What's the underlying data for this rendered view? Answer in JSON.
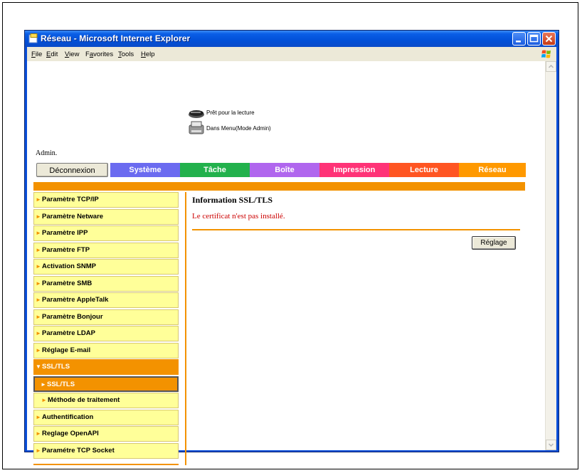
{
  "window": {
    "title": "Réseau - Microsoft Internet Explorer"
  },
  "menu": [
    {
      "u": "F",
      "rest": "ile"
    },
    {
      "u": "E",
      "rest": "dit"
    },
    {
      "u": "V",
      "rest": "iew"
    },
    {
      "u": "",
      "pre": "F",
      "mid": "a",
      "rest": "vorites"
    },
    {
      "u": "T",
      "rest": "ools"
    },
    {
      "u": "H",
      "rest": "elp"
    }
  ],
  "status": {
    "line1": "Prêt pour la lecture",
    "line2": "Dans Menu(Mode Admin)"
  },
  "admin_label": "Admin.",
  "nav": {
    "logout": "Déconnexion",
    "tabs": [
      {
        "label": "Système",
        "color": "#6b6bf0"
      },
      {
        "label": "Tâche",
        "color": "#22b14c"
      },
      {
        "label": "Boîte",
        "color": "#b066ee"
      },
      {
        "label": "Impression",
        "color": "#ff3377"
      },
      {
        "label": "Lecture",
        "color": "#ff5522"
      },
      {
        "label": "Réseau",
        "color": "#ff9900"
      }
    ]
  },
  "sidebar": {
    "items": [
      {
        "label": "Paramètre TCP/IP"
      },
      {
        "label": "Paramètre Netware"
      },
      {
        "label": "Paramètre IPP"
      },
      {
        "label": "Paramètre FTP"
      },
      {
        "label": "Activation SNMP"
      },
      {
        "label": "Paramètre SMB"
      },
      {
        "label": "Paramètre AppleTalk"
      },
      {
        "label": "Paramètre Bonjour"
      },
      {
        "label": "Paramètre LDAP"
      },
      {
        "label": "Réglage E-mail"
      },
      {
        "label": "SSL/TLS"
      },
      {
        "label": "SSL/TLS"
      },
      {
        "label": "Méthode de traitement"
      },
      {
        "label": "Authentification"
      },
      {
        "label": "Reglage OpenAPI"
      },
      {
        "label": "Paramétre TCP Socket"
      }
    ]
  },
  "main": {
    "title": "Information SSL/TLS",
    "message": "Le certificat n'est pas installé.",
    "button": "Réglage"
  },
  "colors": {
    "accent": "#f39200",
    "sidebar_bg": "#ffff99",
    "error": "#cc0000"
  }
}
